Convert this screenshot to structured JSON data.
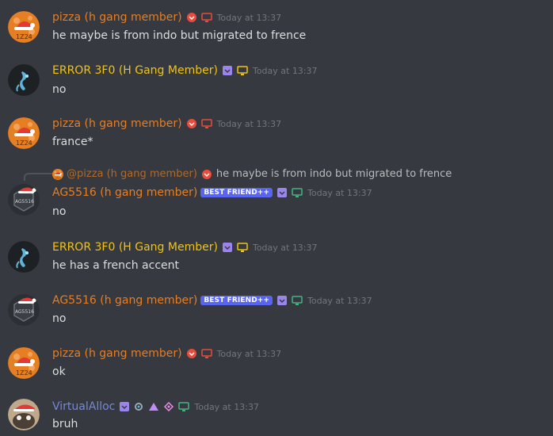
{
  "colors": {
    "pizza": "#e67e22",
    "error": "#f1c40f",
    "ag": "#e67e22",
    "virtual": "#7289da",
    "timestamp": "#72767d"
  },
  "messages": [
    {
      "author": "pizza (h gang member)",
      "timestamp": "Today at 13:37",
      "text": "he maybe is from indo but migrated to frence"
    },
    {
      "author": "ERROR 3F0 (H Gang Member)",
      "timestamp": "Today at 13:37",
      "text": "no"
    },
    {
      "author": "pizza (h gang member)",
      "timestamp": "Today at 13:37",
      "text": "france*"
    },
    {
      "reply": {
        "mention": "@pizza (h gang member)",
        "text": "he maybe is from indo but migrated to frence"
      },
      "author": "AG5516 (h gang member)",
      "badge": "BEST FRIEND++",
      "timestamp": "Today at 13:37",
      "text": "no",
      "avatar_text": "AG5516"
    },
    {
      "author": "ERROR 3F0 (H Gang Member)",
      "timestamp": "Today at 13:37",
      "text": "he has a french accent"
    },
    {
      "author": "AG5516 (h gang member)",
      "badge": "BEST FRIEND++",
      "timestamp": "Today at 13:37",
      "text": "no",
      "avatar_text": "AG5516"
    },
    {
      "author": "pizza (h gang member)",
      "timestamp": "Today at 13:37",
      "text": "ok"
    },
    {
      "author": "VirtualAlloc",
      "timestamp": "Today at 13:37",
      "text": "bruh"
    }
  ]
}
